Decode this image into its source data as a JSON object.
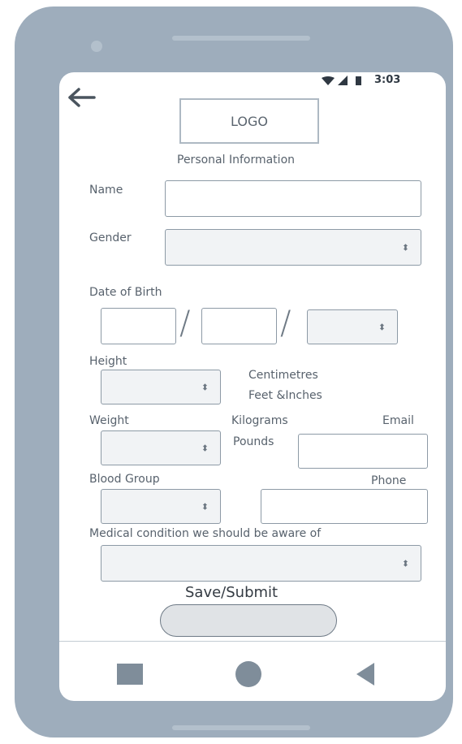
{
  "status_bar": {
    "time": "3:03"
  },
  "header": {
    "logo": "LOGO",
    "section_title": "Personal Information"
  },
  "form": {
    "name_label": "Name",
    "gender_label": "Gender",
    "dob_label": "Date of Birth",
    "height_label": "Height",
    "height_units": [
      "Centimetres",
      "Feet &Inches"
    ],
    "weight_label": "Weight",
    "weight_units": [
      "Kilograms",
      "Pounds"
    ],
    "email_label": "Email",
    "blood_group_label": "Blood Group",
    "phone_label": "Phone",
    "medical_label": "Medical condition we should be aware of",
    "submit_label": "Save/Submit",
    "dob_separator": "/",
    "select_caret": "⬍"
  },
  "icons": {
    "back": "back-arrow-icon",
    "wifi": "wifi-icon",
    "signal": "signal-icon",
    "battery": "battery-icon",
    "recent_apps": "square-icon",
    "home": "circle-icon",
    "back_nav": "triangle-icon"
  },
  "colors": {
    "phone_body": "#9eadbc",
    "screen": "#ffffff",
    "nav_icons": "#7f8d9a"
  }
}
